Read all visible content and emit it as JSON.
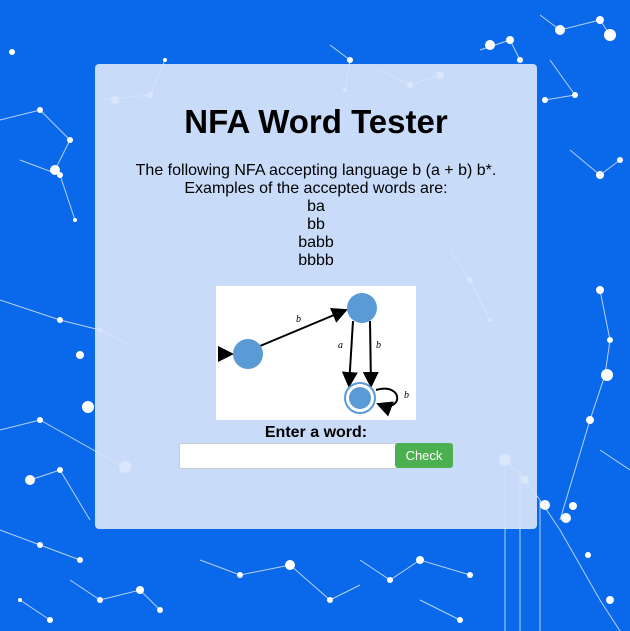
{
  "page": {
    "title": "NFA Word Tester",
    "description": "The following NFA accepting language b (a + b) b*.",
    "examples_intro": "Examples of the accepted words are:",
    "examples": [
      "ba",
      "bb",
      "babb",
      "bbbb"
    ]
  },
  "diagram": {
    "edge_labels": {
      "q0_q1": "b",
      "q1_q2_a": "a",
      "q1_q2_b": "b",
      "q2_loop": "b"
    },
    "state_color": "#5b9bd5"
  },
  "form": {
    "prompt": "Enter a word:",
    "input_value": "",
    "input_placeholder": "",
    "button_label": "Check",
    "button_color": "#4caf50"
  },
  "colors": {
    "background": "#0a68ea",
    "card": "#d7e4fa"
  }
}
